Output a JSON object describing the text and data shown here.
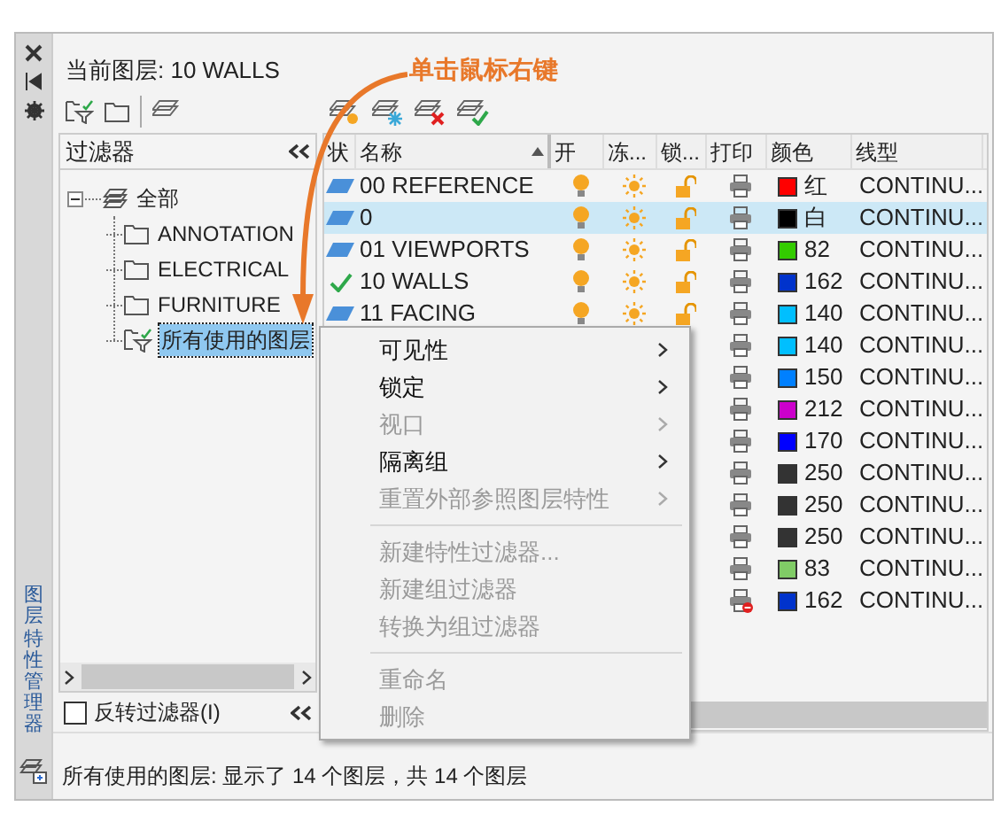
{
  "side_panel": {
    "title": "图层特性管理器"
  },
  "current_layer": "当前图层: 10 WALLS",
  "annotation": "单击鼠标右键",
  "filters": {
    "title": "过滤器",
    "tree": [
      {
        "label": "全部",
        "kind": "all",
        "expanded": true,
        "selected": false,
        "children": [
          {
            "label": "ANNOTATION",
            "kind": "group",
            "selected": false
          },
          {
            "label": "ELECTRICAL",
            "kind": "group",
            "selected": false
          },
          {
            "label": "FURNITURE",
            "kind": "group",
            "selected": false
          },
          {
            "label": "所有使用的图层",
            "kind": "property",
            "selected": true
          }
        ]
      }
    ],
    "invert": {
      "label": "反转过滤器(I)",
      "checked": false
    }
  },
  "table": {
    "columns": [
      {
        "label": "状",
        "sorted": false
      },
      {
        "label": "名称",
        "sorted": true
      },
      {
        "label": "开",
        "sorted": false
      },
      {
        "label": "冻...",
        "sorted": false
      },
      {
        "label": "锁...",
        "sorted": false
      },
      {
        "label": "打印",
        "sorted": false
      },
      {
        "label": "颜色",
        "sorted": false
      },
      {
        "label": "线型",
        "sorted": false
      }
    ],
    "rows": [
      {
        "current": false,
        "name": "00 REFERENCE",
        "selected": false,
        "on": true,
        "frozen": false,
        "locked": false,
        "plot": true,
        "color": "#ff0000",
        "color_label": "红",
        "linetype": "CONTINU..."
      },
      {
        "current": false,
        "name": "0",
        "selected": true,
        "on": true,
        "frozen": false,
        "locked": false,
        "plot": true,
        "color": "#000000",
        "color_label": "白",
        "linetype": "CONTINU..."
      },
      {
        "current": false,
        "name": "01 VIEWPORTS",
        "selected": false,
        "on": true,
        "frozen": false,
        "locked": false,
        "plot": true,
        "color": "#33cc00",
        "color_label": "82",
        "linetype": "CONTINU..."
      },
      {
        "current": true,
        "name": "10 WALLS",
        "selected": false,
        "on": true,
        "frozen": false,
        "locked": false,
        "plot": true,
        "color": "#0033cc",
        "color_label": "162",
        "linetype": "CONTINU..."
      },
      {
        "current": false,
        "name": "11 FACING",
        "selected": false,
        "on": true,
        "frozen": false,
        "locked": false,
        "plot": true,
        "color": "#00bfff",
        "color_label": "140",
        "linetype": "CONTINU..."
      },
      {
        "plot": true,
        "color": "#00bfff",
        "color_label": "140",
        "linetype": "CONTINU..."
      },
      {
        "plot": true,
        "color": "#0080ff",
        "color_label": "150",
        "linetype": "CONTINU..."
      },
      {
        "plot": true,
        "color": "#cc00cc",
        "color_label": "212",
        "linetype": "CONTINU..."
      },
      {
        "plot": true,
        "color": "#0000ff",
        "color_label": "170",
        "linetype": "CONTINU..."
      },
      {
        "plot": true,
        "color": "#333333",
        "color_label": "250",
        "linetype": "CONTINU..."
      },
      {
        "plot": true,
        "color": "#333333",
        "color_label": "250",
        "linetype": "CONTINU..."
      },
      {
        "plot": true,
        "color": "#333333",
        "color_label": "250",
        "linetype": "CONTINU..."
      },
      {
        "plot": true,
        "color": "#80cc66",
        "color_label": "83",
        "linetype": "CONTINU..."
      },
      {
        "plot": false,
        "color": "#0033cc",
        "color_label": "162",
        "linetype": "CONTINU..."
      }
    ]
  },
  "context_menu": {
    "items": [
      {
        "kind": "item",
        "label": "可见性",
        "submenu": true,
        "disabled": false
      },
      {
        "kind": "item",
        "label": "锁定",
        "submenu": true,
        "disabled": false
      },
      {
        "kind": "item",
        "label": "视口",
        "submenu": true,
        "disabled": true
      },
      {
        "kind": "item",
        "label": "隔离组",
        "submenu": true,
        "disabled": false
      },
      {
        "kind": "item",
        "label": "重置外部参照图层特性",
        "submenu": true,
        "disabled": true
      },
      {
        "kind": "separator"
      },
      {
        "kind": "item",
        "label": "新建特性过滤器...",
        "submenu": false,
        "disabled": true
      },
      {
        "kind": "item",
        "label": "新建组过滤器",
        "submenu": false,
        "disabled": true
      },
      {
        "kind": "item",
        "label": "转换为组过滤器",
        "submenu": false,
        "disabled": true
      },
      {
        "kind": "separator"
      },
      {
        "kind": "item",
        "label": "重命名",
        "submenu": false,
        "disabled": true
      },
      {
        "kind": "item",
        "label": "删除",
        "submenu": false,
        "disabled": true
      }
    ]
  },
  "status_bar": "所有使用的图层: 显示了 14 个图层，共 14 个图层"
}
